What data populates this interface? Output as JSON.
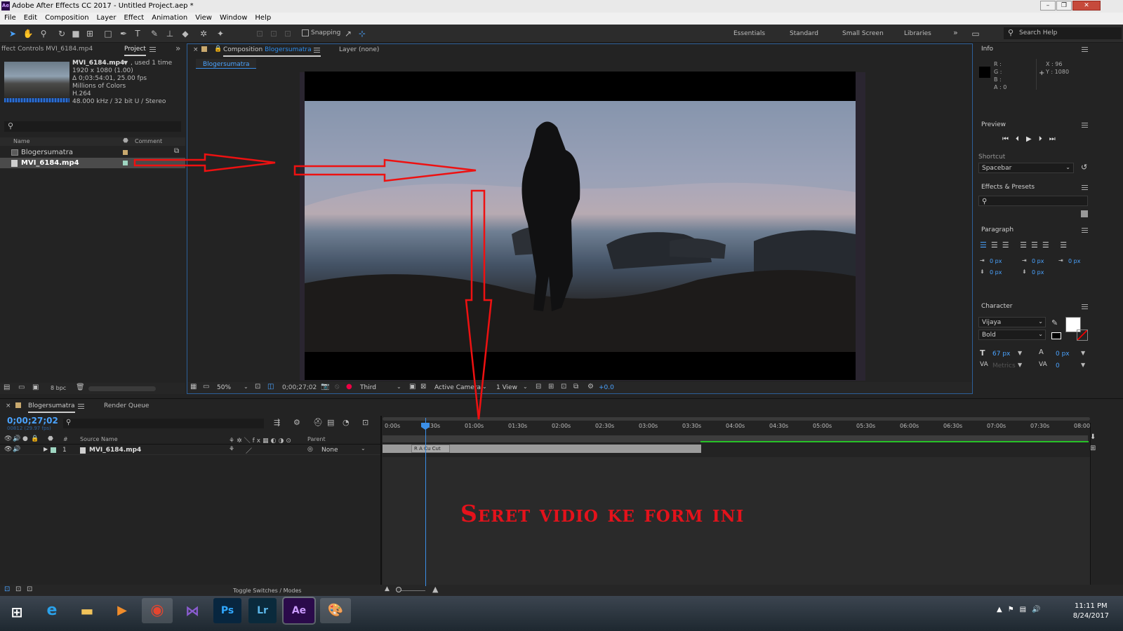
{
  "window": {
    "title": "Adobe After Effects CC 2017 - Untitled Project.aep *",
    "app_icon": "Ae"
  },
  "menu": [
    "File",
    "Edit",
    "Composition",
    "Layer",
    "Effect",
    "Animation",
    "View",
    "Window",
    "Help"
  ],
  "toolbar": {
    "snapping": "Snapping",
    "workspaces": [
      "Essentials",
      "Standard",
      "Small Screen",
      "Libraries"
    ],
    "search_help": "Search Help"
  },
  "project": {
    "tab_effect_controls": "ffect Controls MVI_6184.mp4",
    "tab_project": "Project",
    "footage": {
      "name": "MVI_6184.mp4",
      "used": ", used 1 time",
      "dims": "1920 x 1080 (1.00)",
      "duration": "Δ 0;03:54:01, 25.00 fps",
      "colors": "Millions of Colors",
      "codec": "H.264",
      "audio": "48.000 kHz / 32 bit U / Stereo"
    },
    "columns": {
      "name": "Name",
      "comment": "Comment"
    },
    "items": [
      {
        "name": "Blogersumatra",
        "type": "comp",
        "label_color": "#c9a96e"
      },
      {
        "name": "MVI_6184.mp4",
        "type": "footage",
        "label_color": "#9fd6c2"
      }
    ],
    "bpc": "8 bpc"
  },
  "composition": {
    "tab_prefix": "Composition",
    "tab_name": "Blogersumatra",
    "layer_tab": "Layer (none)",
    "subtab": "Blogersumatra",
    "zoom": "50%",
    "timecode": "0;00;27;02",
    "resolution": "Third",
    "camera": "Active Camera",
    "view": "1 View",
    "exposure": "+0.0"
  },
  "info": {
    "title": "Info",
    "r": "R :",
    "g": "G :",
    "b": "B :",
    "a": "A : 0",
    "x": "X : 96",
    "y": "Y : 1080"
  },
  "preview": {
    "title": "Preview",
    "shortcut_label": "Shortcut",
    "shortcut_value": "Spacebar"
  },
  "effects_presets": {
    "title": "Effects & Presets"
  },
  "paragraph": {
    "title": "Paragraph",
    "values": [
      "0 px",
      "0 px",
      "0 px",
      "0 px",
      "0 px"
    ]
  },
  "character": {
    "title": "Character",
    "font": "Vijaya",
    "style": "Bold",
    "size": "67 px",
    "leading": "0 px",
    "tracking_label": "Metrics",
    "tracking_value": "0"
  },
  "timeline": {
    "tab": "Blogersumatra",
    "render_queue": "Render Queue",
    "timecode": "0;00;27;02",
    "sub_timecode": "00812 (29.97 fps)",
    "columns": {
      "source": "Source Name",
      "parent": "Parent",
      "num": "#"
    },
    "layer": {
      "index": "1",
      "name": "MVI_6184.mp4",
      "parent": "None"
    },
    "ticks": [
      "0:00s",
      "00:30s",
      "01:00s",
      "01:30s",
      "02:00s",
      "02:30s",
      "03:00s",
      "03:30s",
      "04:00s",
      "04:30s",
      "05:00s",
      "05:30s",
      "06:00s",
      "06:30s",
      "07:00s",
      "07:30s",
      "08:00"
    ],
    "markers": "R  A  Cu  Cut",
    "toggle": "Toggle Switches / Modes"
  },
  "annotation": {
    "text": "Seret vidio ke form ini",
    "color": "#e4121b"
  },
  "taskbar": {
    "apps": [
      "windows-start",
      "ie",
      "explorer",
      "media-player",
      "chrome",
      "visual-studio",
      "photoshop",
      "lightroom",
      "after-effects",
      "paint"
    ],
    "ps": "Ps",
    "lr": "Lr",
    "ae": "Ae",
    "time": "11:11 PM",
    "date": "8/24/2017"
  }
}
